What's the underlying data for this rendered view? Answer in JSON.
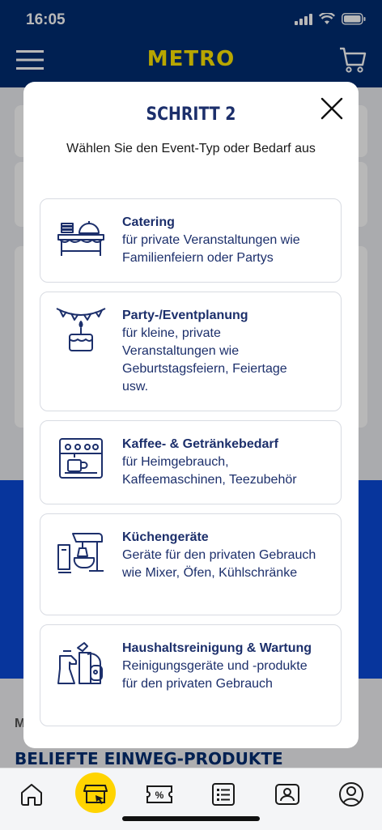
{
  "status": {
    "time": "16:05"
  },
  "header": {
    "logo": "METRO",
    "menu_icon": "menu-icon",
    "cart_icon": "cart-icon"
  },
  "background": {
    "section_small": "M",
    "section_title": "BELIEFTE EINWEG-PRODUKTE"
  },
  "modal": {
    "title": "SCHRITT 2",
    "subtitle": "Wählen Sie den Event-Typ oder Bedarf aus",
    "close_icon": "close-icon",
    "options": [
      {
        "title": "Catering",
        "description": "für private Veranstaltungen wie Familienfeiern oder Partys",
        "icon": "catering-icon"
      },
      {
        "title": "Party-/Eventplanung",
        "description": "für kleine, private Veranstaltungen wie Geburtstagsfeiern, Feiertage usw.",
        "icon": "party-icon"
      },
      {
        "title": "Kaffee- & Getränkebedarf",
        "description": "für Heimgebrauch, Kaffeemaschinen, Teezubehör",
        "icon": "coffee-machine-icon"
      },
      {
        "title": "Küchengeräte",
        "description": "Geräte für den privaten Gebrauch wie Mixer, Öfen, Kühlschränke",
        "icon": "kitchen-appliance-icon"
      },
      {
        "title": "Haushaltsreinigung & Wartung",
        "description": "Reinigungsgeräte und -produkte für den privaten Gebrauch",
        "icon": "cleaning-icon"
      }
    ]
  },
  "bottom_nav": {
    "items": [
      "home-icon",
      "store-icon",
      "coupon-icon",
      "list-icon",
      "card-icon",
      "profile-icon"
    ]
  },
  "colors": {
    "brand_blue": "#002d72",
    "brand_yellow": "#ffe600",
    "text_navy": "#1c2f6b"
  }
}
